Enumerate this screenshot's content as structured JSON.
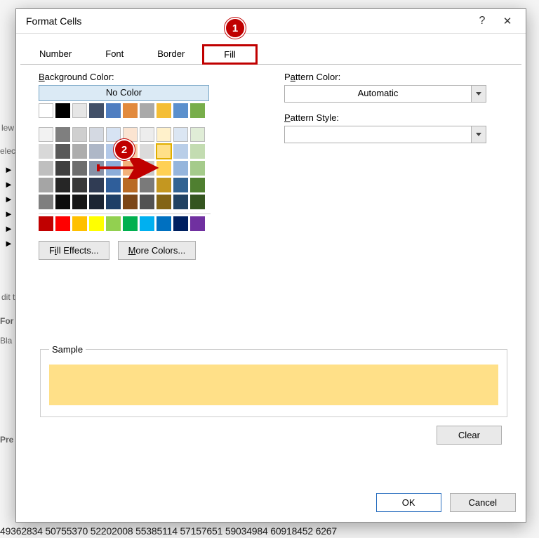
{
  "dialog": {
    "title": "Format Cells",
    "help": "?",
    "close": "✕",
    "tabs": {
      "number": "Number",
      "font": "Font",
      "border": "Border",
      "fill": "Fill"
    },
    "fill": {
      "bg_color_label": "Background Color:",
      "no_color": "No Color",
      "fill_effects": "Fill Effects...",
      "more_colors": "More Colors...",
      "pattern_color_label": "Pattern Color:",
      "pattern_color_value": "Automatic",
      "pattern_style_label": "Pattern Style:",
      "pattern_style_value": ""
    },
    "sample_label": "Sample",
    "sample_color": "#ffe088",
    "clear": "Clear",
    "ok": "OK",
    "cancel": "Cancel"
  },
  "callouts": {
    "one": "1",
    "two": "2"
  },
  "colors": {
    "row1": [
      "#ffffff",
      "#000000",
      "#e6e6e6",
      "#425068",
      "#4f7ec1",
      "#e28a3d",
      "#a9a9a9",
      "#f4be36",
      "#5b90cd",
      "#78ae4b"
    ],
    "row2": [
      "#f2f2f2",
      "#7f7f7f",
      "#cfcfcf",
      "#d4d9e2",
      "#d7e3f3",
      "#fbe4d1",
      "#ededed",
      "#fff1cb",
      "#dbe6f3",
      "#e0edd7"
    ],
    "row3": [
      "#d8d8d8",
      "#595959",
      "#adadad",
      "#aeb7c7",
      "#b2c8e8",
      "#f7cba6",
      "#dbdbdb",
      "#ffe088",
      "#b9cee8",
      "#c3dcb1"
    ],
    "row4": [
      "#bfbfbf",
      "#3f3f3f",
      "#6e6e6e",
      "#8792a7",
      "#8cadd9",
      "#f3b27b",
      "#c9c9c9",
      "#ffd054",
      "#95b5dc",
      "#a5cb8b"
    ],
    "row5": [
      "#a5a5a5",
      "#262626",
      "#393939",
      "#303c54",
      "#2f5e9a",
      "#b96a24",
      "#7a7a7a",
      "#c49720",
      "#326392",
      "#4f7f30"
    ],
    "row6": [
      "#7f7f7f",
      "#0c0c0c",
      "#161616",
      "#1c2533",
      "#1e3f67",
      "#7c4617",
      "#525252",
      "#836415",
      "#214262",
      "#355520"
    ],
    "std": [
      "#c00000",
      "#ff0000",
      "#ffc000",
      "#ffff00",
      "#92d050",
      "#00b050",
      "#00b0f0",
      "#0070c0",
      "#002060",
      "#7030a0"
    ]
  },
  "bg_numbers": "49362834  50755370  52202008                           55385114  57157651  59034984  60918452  6267"
}
